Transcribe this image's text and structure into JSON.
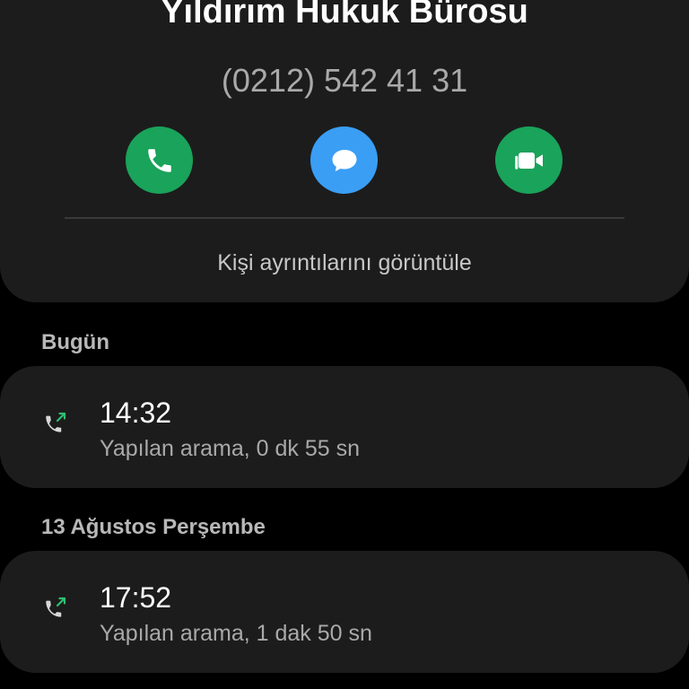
{
  "contact": {
    "name": "Yıldırım Hukuk Bürosu",
    "phone": "(0212) 542 41 31",
    "view_details_label": "Kişi ayrıntılarını görüntüle"
  },
  "actions": {
    "call_icon": "phone-icon",
    "message_icon": "chat-bubble-icon",
    "video_icon": "video-camera-icon",
    "call_color": "#1aa35a",
    "message_color": "#3a9ef5",
    "video_color": "#1aa35a"
  },
  "call_log": [
    {
      "section": "Bugün",
      "time": "14:32",
      "detail": "Yapılan arama, 0 dk 55 sn",
      "icon": "outgoing-call-icon"
    },
    {
      "section": "13 Ağustos Perşembe",
      "time": "17:52",
      "detail": "Yapılan arama, 1 dak 50 sn",
      "icon": "outgoing-call-icon"
    }
  ],
  "colors": {
    "background": "#000000",
    "card": "#1c1c1c",
    "outgoing_arrow": "#2fbf6f"
  }
}
